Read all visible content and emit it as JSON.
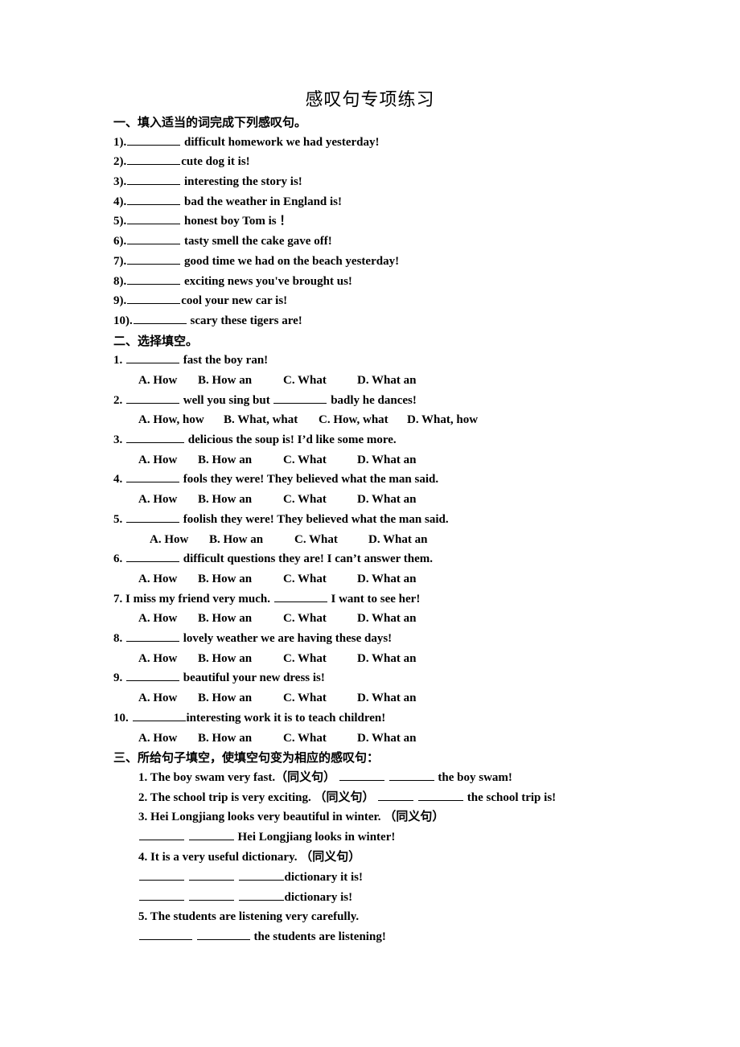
{
  "document": {
    "title": "感叹句专项练习"
  },
  "section1": {
    "heading": "一、填入适当的词完成下列感叹句。",
    "items": [
      {
        "num": "1).",
        "text": "difficult homework we had yesterday!"
      },
      {
        "num": "2).",
        "text": "cute dog it is!"
      },
      {
        "num": "3).",
        "text": "interesting the story is!"
      },
      {
        "num": "4).",
        "text": "bad the weather in England is!"
      },
      {
        "num": "5).",
        "text": "honest boy Tom is ！"
      },
      {
        "num": "6).",
        "text": "tasty smell the cake gave off!"
      },
      {
        "num": "7).",
        "text": "good time we had on the beach yesterday!"
      },
      {
        "num": "8).",
        "text": "exciting news you've brought us!"
      },
      {
        "num": "9).",
        "text": "cool your new car is!"
      },
      {
        "num": "10).",
        "text": "scary these tigers are!"
      }
    ]
  },
  "section2": {
    "heading": "二、选择填空。",
    "items": [
      {
        "num": "1.",
        "stem": "fast the boy ran!",
        "options": [
          "A. How",
          "B. How an",
          "C. What",
          "D. What an"
        ]
      },
      {
        "num": "2.",
        "stem_a": "well you sing but",
        "stem_b": "badly he dances!",
        "options": [
          "A. How, how",
          "B. What, what",
          "C. How, what",
          "D. What, how"
        ]
      },
      {
        "num": "3.",
        "stem": "delicious the soup is! I’d like some more.",
        "options": [
          "A. How",
          "B. How an",
          "C. What",
          "D. What an"
        ]
      },
      {
        "num": "4.",
        "stem": "fools they were! They believed what the man said.",
        "options": [
          "A. How",
          "B. How an",
          "C. What",
          "D. What an"
        ]
      },
      {
        "num": "5.",
        "stem": "foolish they were! They believed what the man said.",
        "options": [
          "A. How",
          "B. How an",
          "C. What",
          "D. What an"
        ]
      },
      {
        "num": "6.",
        "stem": "difficult questions they are! I can’t answer them.",
        "options": [
          "A. How",
          "B. How an",
          "C. What",
          "D. What an"
        ]
      },
      {
        "num": "7.",
        "stem_a": "I miss my friend very much.",
        "stem_b": "I want to see her!",
        "options": [
          "A. How",
          "B. How an",
          "C. What",
          "D. What an"
        ]
      },
      {
        "num": "8.",
        "stem": "lovely weather we are having these days!",
        "options": [
          "A. How",
          "B. How an",
          "C. What",
          "D. What an"
        ]
      },
      {
        "num": "9.",
        "stem": "beautiful your new dress is!",
        "options": [
          "A. How",
          "B. How an",
          "C. What",
          "D. What an"
        ]
      },
      {
        "num": "10.",
        "stem": "interesting work it is to teach children!",
        "options": [
          "A. How",
          "B. How an",
          "C. What",
          "D. What an"
        ]
      }
    ]
  },
  "section3": {
    "heading": "三、所给句子填空，使填空句变为相应的感叹句：",
    "items": [
      {
        "num": "1.",
        "sentence": "The boy swam very fast.",
        "tag": "（同义句）",
        "tail": "the boy swam!"
      },
      {
        "num": "2.",
        "sentence": "The school trip is very exciting.",
        "tag": "（同义句）",
        "tail": "the school trip is!"
      },
      {
        "num": "3.",
        "sentence": "Hei Longjiang looks very beautiful in winter.",
        "tag": "（同义句）",
        "answer_tail": "Hei Longjiang looks in winter!"
      },
      {
        "num": "4.",
        "sentence": "It is a very useful dictionary.",
        "tag": "（同义句）",
        "answer_tail_1": "dictionary it is!",
        "answer_tail_2": "dictionary is!"
      },
      {
        "num": "5.",
        "sentence": "The students are listening very carefully.",
        "answer_tail": "the students are listening!"
      }
    ]
  }
}
